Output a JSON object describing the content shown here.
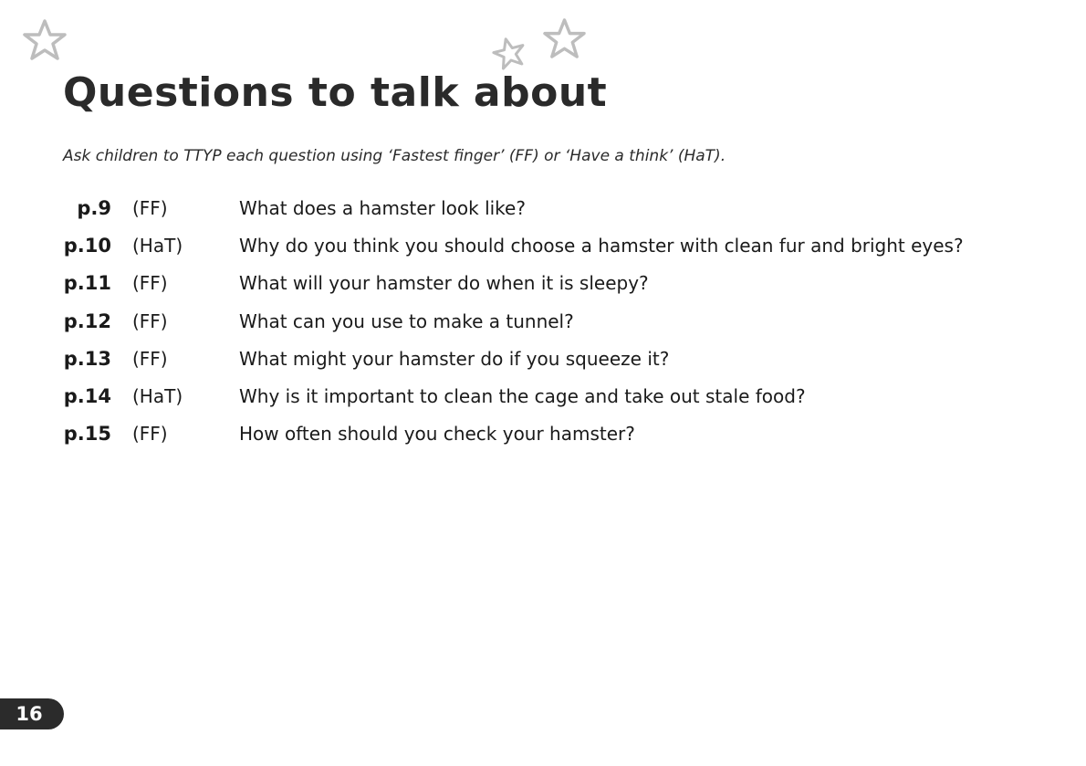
{
  "title": "Questions to talk about",
  "instruction": "Ask children to TTYP each question using ‘Fastest finger’ (FF) or ‘Have a think’ (HaT).",
  "questions": [
    {
      "page": "p.9",
      "type": "(FF)",
      "text": "What does a hamster look like?"
    },
    {
      "page": "p.10",
      "type": "(HaT)",
      "text": "Why do you think you should choose a hamster with clean fur and bright eyes?"
    },
    {
      "page": "p.11",
      "type": "(FF)",
      "text": "What will your hamster do when it is sleepy?"
    },
    {
      "page": "p.12",
      "type": "(FF)",
      "text": "What can you use to make a tunnel?"
    },
    {
      "page": "p.13",
      "type": "(FF)",
      "text": "What might your hamster do if you squeeze it?"
    },
    {
      "page": "p.14",
      "type": "(HaT)",
      "text": "Why is it important to clean the cage and take out stale food?"
    },
    {
      "page": "p.15",
      "type": "(FF)",
      "text": "How often should you check your hamster?"
    }
  ],
  "page_number": "16",
  "colors": {
    "text": "#1a1a1a",
    "star_outline": "#bdbdbd",
    "badge_background": "#2b2b2b",
    "badge_text": "#ffffff"
  },
  "icons": {
    "decoration": "star-outline-icon"
  }
}
